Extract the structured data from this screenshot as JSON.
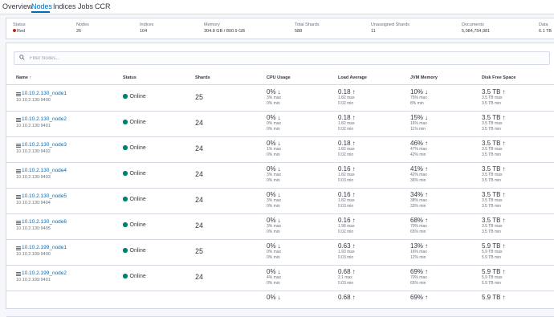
{
  "tabs": [
    {
      "label": "Overview",
      "active": false
    },
    {
      "label": "Nodes",
      "active": true
    },
    {
      "label": "Indices",
      "active": false
    },
    {
      "label": "Jobs",
      "active": false
    },
    {
      "label": "CCR",
      "active": false
    }
  ],
  "summary": {
    "status": {
      "label": "Status",
      "value": "Red"
    },
    "nodes": {
      "label": "Nodes",
      "value": "26"
    },
    "indices": {
      "label": "Indices",
      "value": "104"
    },
    "memory": {
      "label": "Memory",
      "value": "304.8 GB / 800.9 GB"
    },
    "total_shards": {
      "label": "Total Shards",
      "value": "588"
    },
    "unassigned_shards": {
      "label": "Unassigned Shards",
      "value": "11"
    },
    "documents": {
      "label": "Documents",
      "value": "5,084,754,981"
    },
    "data": {
      "label": "Data",
      "value": "6.1 TB"
    }
  },
  "filter": {
    "placeholder": "Filter Nodes..."
  },
  "columns": {
    "name": "Name",
    "status": "Status",
    "shards": "Shards",
    "cpu": "CPU Usage",
    "load": "Load Average",
    "jvm": "JVM Memory",
    "disk": "Disk Free Space"
  },
  "rows": [
    {
      "name": "10.10.2.130_node1",
      "addr": "10.10.2.130:9400",
      "status": "Online",
      "shards": "25",
      "cpu": {
        "v": "0%",
        "d": "down",
        "max": "3% max",
        "min": "0% min"
      },
      "load": {
        "v": "0.18",
        "d": "up",
        "max": "1.82 max",
        "min": "0.02 min"
      },
      "jvm": {
        "v": "10%",
        "d": "down",
        "max": "75% max",
        "min": "8% min"
      },
      "disk": {
        "v": "3.5 TB",
        "d": "up",
        "max": "3.5 TB max",
        "min": "3.5 TB min"
      }
    },
    {
      "name": "10.10.2.130_node2",
      "addr": "10.10.2.130:9401",
      "status": "Online",
      "shards": "24",
      "cpu": {
        "v": "0%",
        "d": "down",
        "max": "0% max",
        "min": "0% min"
      },
      "load": {
        "v": "0.18",
        "d": "up",
        "max": "1.82 max",
        "min": "0.02 min"
      },
      "jvm": {
        "v": "15%",
        "d": "down",
        "max": "16% max",
        "min": "11% min"
      },
      "disk": {
        "v": "3.5 TB",
        "d": "up",
        "max": "3.5 TB max",
        "min": "3.5 TB min"
      }
    },
    {
      "name": "10.10.2.130_node3",
      "addr": "10.10.2.130:9402",
      "status": "Online",
      "shards": "24",
      "cpu": {
        "v": "0%",
        "d": "down",
        "max": "1% max",
        "min": "0% min"
      },
      "load": {
        "v": "0.18",
        "d": "up",
        "max": "1.82 max",
        "min": "0.02 min"
      },
      "jvm": {
        "v": "46%",
        "d": "up",
        "max": "47% max",
        "min": "42% min"
      },
      "disk": {
        "v": "3.5 TB",
        "d": "up",
        "max": "3.5 TB max",
        "min": "3.5 TB min"
      }
    },
    {
      "name": "10.10.2.130_node4",
      "addr": "10.10.2.130:9403",
      "status": "Online",
      "shards": "24",
      "cpu": {
        "v": "0%",
        "d": "down",
        "max": "3% max",
        "min": "0% min"
      },
      "load": {
        "v": "0.16",
        "d": "up",
        "max": "1.82 max",
        "min": "0.03 min"
      },
      "jvm": {
        "v": "41%",
        "d": "up",
        "max": "42% max",
        "min": "36% min"
      },
      "disk": {
        "v": "3.5 TB",
        "d": "up",
        "max": "3.5 TB max",
        "min": "3.5 TB min"
      }
    },
    {
      "name": "10.10.2.130_node5",
      "addr": "10.10.2.130:9404",
      "status": "Online",
      "shards": "24",
      "cpu": {
        "v": "0%",
        "d": "down",
        "max": "3% max",
        "min": "0% min"
      },
      "load": {
        "v": "0.16",
        "d": "up",
        "max": "1.82 max",
        "min": "0.03 min"
      },
      "jvm": {
        "v": "34%",
        "d": "up",
        "max": "38% max",
        "min": "33% min"
      },
      "disk": {
        "v": "3.5 TB",
        "d": "up",
        "max": "3.5 TB max",
        "min": "3.5 TB min"
      }
    },
    {
      "name": "10.10.2.130_node6",
      "addr": "10.10.2.130:9405",
      "status": "Online",
      "shards": "24",
      "cpu": {
        "v": "0%",
        "d": "down",
        "max": "3% max",
        "min": "0% min"
      },
      "load": {
        "v": "0.16",
        "d": "up",
        "max": "1.98 max",
        "min": "0.02 min"
      },
      "jvm": {
        "v": "68%",
        "d": "up",
        "max": "70% max",
        "min": "65% min"
      },
      "disk": {
        "v": "3.5 TB",
        "d": "up",
        "max": "3.5 TB max",
        "min": "3.5 TB min"
      }
    },
    {
      "name": "10.10.2.199_node1",
      "addr": "10.10.2.199:9400",
      "status": "Online",
      "shards": "25",
      "cpu": {
        "v": "0%",
        "d": "down",
        "max": "0% max",
        "min": "0% min"
      },
      "load": {
        "v": "0.63",
        "d": "up",
        "max": "1.93 max",
        "min": "0.03 min"
      },
      "jvm": {
        "v": "13%",
        "d": "up",
        "max": "16% max",
        "min": "12% min"
      },
      "disk": {
        "v": "5.9 TB",
        "d": "up",
        "max": "5.9 TB max",
        "min": "5.9 TB min"
      }
    },
    {
      "name": "10.10.2.199_node2",
      "addr": "10.10.2.199:9401",
      "status": "Online",
      "shards": "24",
      "cpu": {
        "v": "0%",
        "d": "down",
        "max": "4% max",
        "min": "0% min"
      },
      "load": {
        "v": "0.68",
        "d": "up",
        "max": "2.1 max",
        "min": "0.03 min"
      },
      "jvm": {
        "v": "69%",
        "d": "up",
        "max": "70% max",
        "min": "65% min"
      },
      "disk": {
        "v": "5.9 TB",
        "d": "up",
        "max": "5.9 TB max",
        "min": "5.9 TB min"
      }
    },
    {
      "name": "",
      "addr": "",
      "status": "",
      "shards": "",
      "cpu": {
        "v": "0%",
        "d": "down",
        "max": "",
        "min": ""
      },
      "load": {
        "v": "0.68",
        "d": "up",
        "max": "",
        "min": ""
      },
      "jvm": {
        "v": "69%",
        "d": "up",
        "max": "",
        "min": ""
      },
      "disk": {
        "v": "5.9 TB",
        "d": "up",
        "max": "",
        "min": ""
      }
    }
  ],
  "colors": {
    "accent": "#006bb4",
    "online": "#017d73",
    "red": "#bd271e"
  },
  "icons": {
    "node": "server-icon",
    "search": "search-icon",
    "sort": "sort-ascending-icon",
    "trend_up": "arrow-up-icon",
    "trend_down": "arrow-down-icon"
  }
}
